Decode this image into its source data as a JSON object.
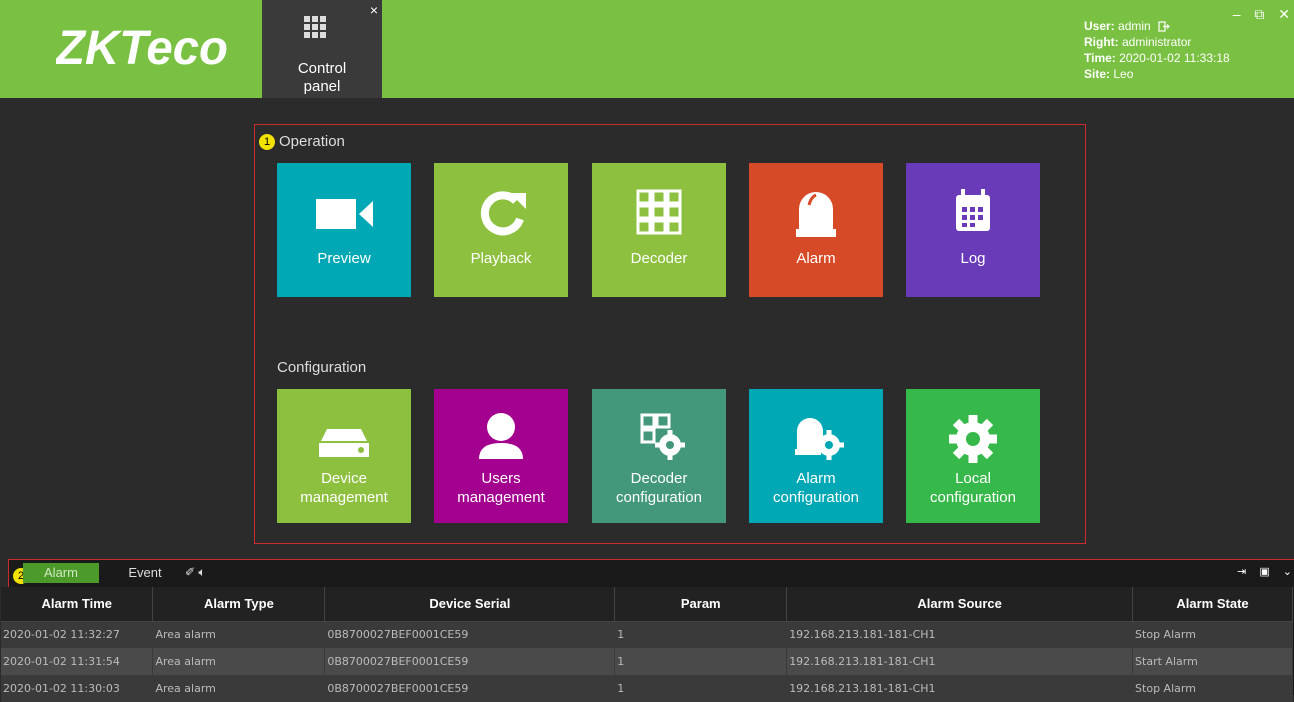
{
  "header": {
    "logo_text": "ZKTeco",
    "control_panel_tab": {
      "label_line1": "Control",
      "label_line2": "panel",
      "close_glyph": "×"
    },
    "user_info": {
      "user_label": "User:",
      "user_value": "admin",
      "right_label": "Right:",
      "right_value": "administrator",
      "time_label": "Time:",
      "time_value": "2020-01-02 11:33:18",
      "site_label": "Site:",
      "site_value": "Leo"
    },
    "window_controls": [
      "minimize-icon",
      "restore-icon",
      "close-icon"
    ]
  },
  "operation": {
    "badge": "1",
    "title": "Operation",
    "tiles": [
      {
        "label": "Preview",
        "icon": "video-camera-icon",
        "color": "#00a8b5"
      },
      {
        "label": "Playback",
        "icon": "refresh-icon",
        "color": "#8dc03f"
      },
      {
        "label": "Decoder",
        "icon": "grid-icon",
        "color": "#8dc03f"
      },
      {
        "label": "Alarm",
        "icon": "alarm-bell-icon",
        "color": "#d64a27"
      },
      {
        "label": "Log",
        "icon": "calendar-icon",
        "color": "#6a3bb8"
      }
    ]
  },
  "configuration": {
    "title": "Configuration",
    "tiles": [
      {
        "label1": "Device",
        "label2": "management",
        "icon": "device-drive-icon",
        "color": "#8dc03f"
      },
      {
        "label1": "Users",
        "label2": "management",
        "icon": "user-icon",
        "color": "#a3008f"
      },
      {
        "label1": "Decoder",
        "label2": "configuration",
        "icon": "grid-gear-icon",
        "color": "#43977a"
      },
      {
        "label1": "Alarm",
        "label2": "configuration",
        "icon": "alarm-gear-icon",
        "color": "#00a8b5"
      },
      {
        "label1": "Local",
        "label2": "configuration",
        "icon": "gear-icon",
        "color": "#37b84a"
      }
    ]
  },
  "dock": {
    "badge": "2",
    "tabs": {
      "alarm": "Alarm",
      "event": "Event"
    },
    "columns": [
      "Alarm Time",
      "Alarm Type",
      "Device Serial",
      "Param",
      "Alarm Source",
      "Alarm State"
    ],
    "rows": [
      [
        "2020-01-02 11:32:27",
        "Area alarm",
        "0B8700027BEF0001CE59",
        "1",
        "192.168.213.181-181-CH1",
        "Stop Alarm"
      ],
      [
        "2020-01-02 11:31:54",
        "Area alarm",
        "0B8700027BEF0001CE59",
        "1",
        "192.168.213.181-181-CH1",
        "Start Alarm"
      ],
      [
        "2020-01-02 11:30:03",
        "Area alarm",
        "0B8700027BEF0001CE59",
        "1",
        "192.168.213.181-181-CH1",
        "Stop Alarm"
      ]
    ]
  }
}
